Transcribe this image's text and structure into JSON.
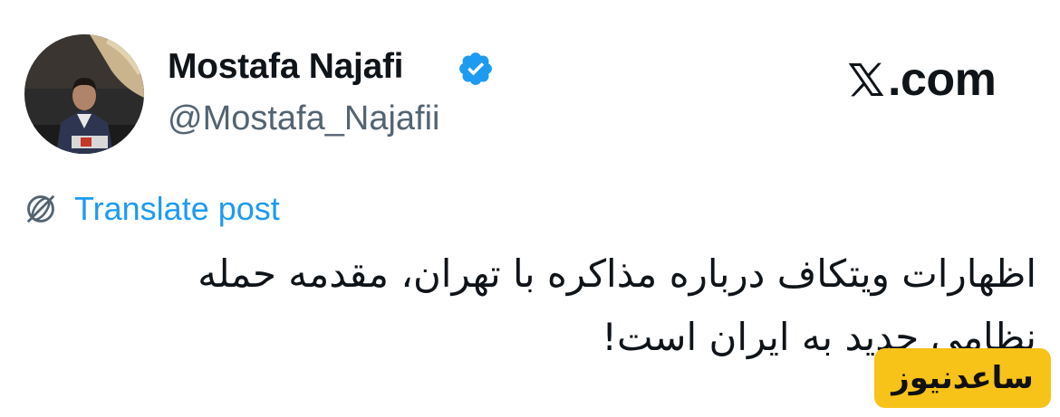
{
  "author": {
    "display_name": "Mostafa Najafi",
    "handle": "@Mostafa_Najafii",
    "verified": true,
    "verified_color": "#1d9bf0"
  },
  "site": {
    "logo_icon": "x-logo-icon",
    "domain_suffix": ".com"
  },
  "translate": {
    "icon": "globe-translate-icon",
    "label": "Translate post",
    "color": "#1d9bf0"
  },
  "post": {
    "lines": [
      "اظهارات ویتکاف درباره مذاکره با تهران، مقدمه حمله",
      "نظامی جدید به ایران است!"
    ]
  },
  "watermark": {
    "text": "ساعدنیوز",
    "background": "#f7c318"
  }
}
